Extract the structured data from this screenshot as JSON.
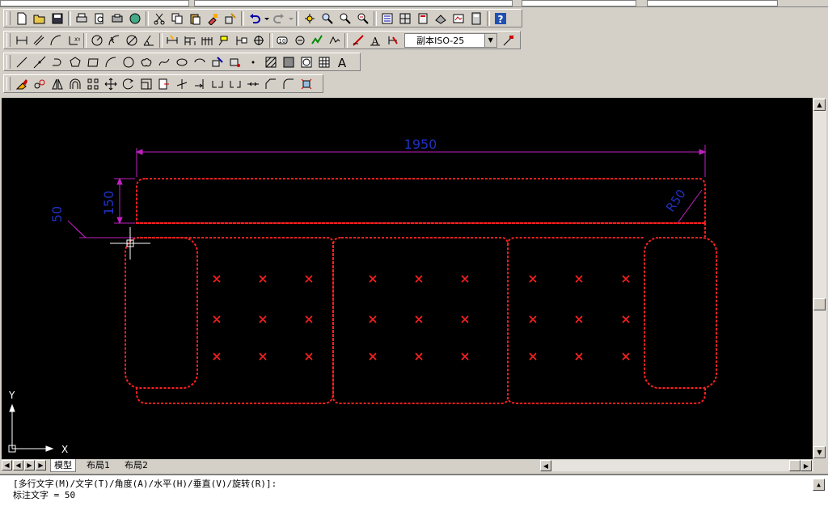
{
  "toolbars": {
    "dimstyle_combo": "副本ISO-25"
  },
  "drawing": {
    "dim_length": "1950",
    "dim_height": "150",
    "dim_small": "50",
    "dim_radius": "R50",
    "ucs_x": "X",
    "ucs_y": "Y",
    "colors": {
      "outline": "#ff2020",
      "dimension": "#c020c0",
      "dim_text": "#2030c0"
    }
  },
  "tabs": {
    "model": "模型",
    "layout1": "布局1",
    "layout2": "布局2"
  },
  "command": {
    "line1": "[多行文字(M)/文字(T)/角度(A)/水平(H)/垂直(V)/旋转(R)]:",
    "line2": "标注文字 = 50"
  }
}
